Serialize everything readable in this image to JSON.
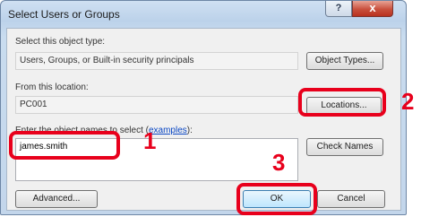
{
  "window": {
    "title": "Select Users or Groups",
    "help_label": "?",
    "close_label": "x"
  },
  "object_type": {
    "label": "Select this object type:",
    "value": "Users, Groups, or Built-in security principals",
    "button": "Object Types..."
  },
  "location": {
    "label": "From this location:",
    "value": "PC001",
    "button": "Locations..."
  },
  "names": {
    "label_prefix": "Enter the object names to select (",
    "label_link": "examples",
    "label_suffix": "):",
    "value": "james.smith",
    "button": "Check Names"
  },
  "footer": {
    "advanced_button": "Advanced...",
    "ok_button": "OK",
    "cancel_button": "Cancel"
  },
  "annotations": {
    "step1": "1",
    "step2": "2",
    "step3": "3",
    "color": "#e8001c"
  }
}
